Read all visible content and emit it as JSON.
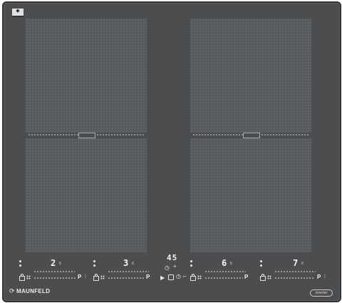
{
  "brand": {
    "name": "MAUNFELD",
    "mark_icon": "maunfeld-logo-icon",
    "corner_badge_icon": "certification-badge-icon",
    "right_badge_text": "inverter"
  },
  "center": {
    "timer_display": "45",
    "icons": [
      "play-icon",
      "timer-icon",
      "minus-plus-icon",
      "pause-icon"
    ]
  },
  "zones": [
    {
      "id": "front-left",
      "display": "2",
      "sub": "8",
      "booster": "P"
    },
    {
      "id": "rear-left",
      "display": "3",
      "sub": "8",
      "booster": "P"
    },
    {
      "id": "rear-right",
      "display": "6",
      "sub": "8",
      "booster": "P"
    },
    {
      "id": "front-right",
      "display": "7",
      "sub": "8",
      "booster": "P"
    }
  ],
  "colors": {
    "glass": "#4b4d4f",
    "zone_fill": "#575a5d",
    "display_text": "#f4f5f6"
  }
}
